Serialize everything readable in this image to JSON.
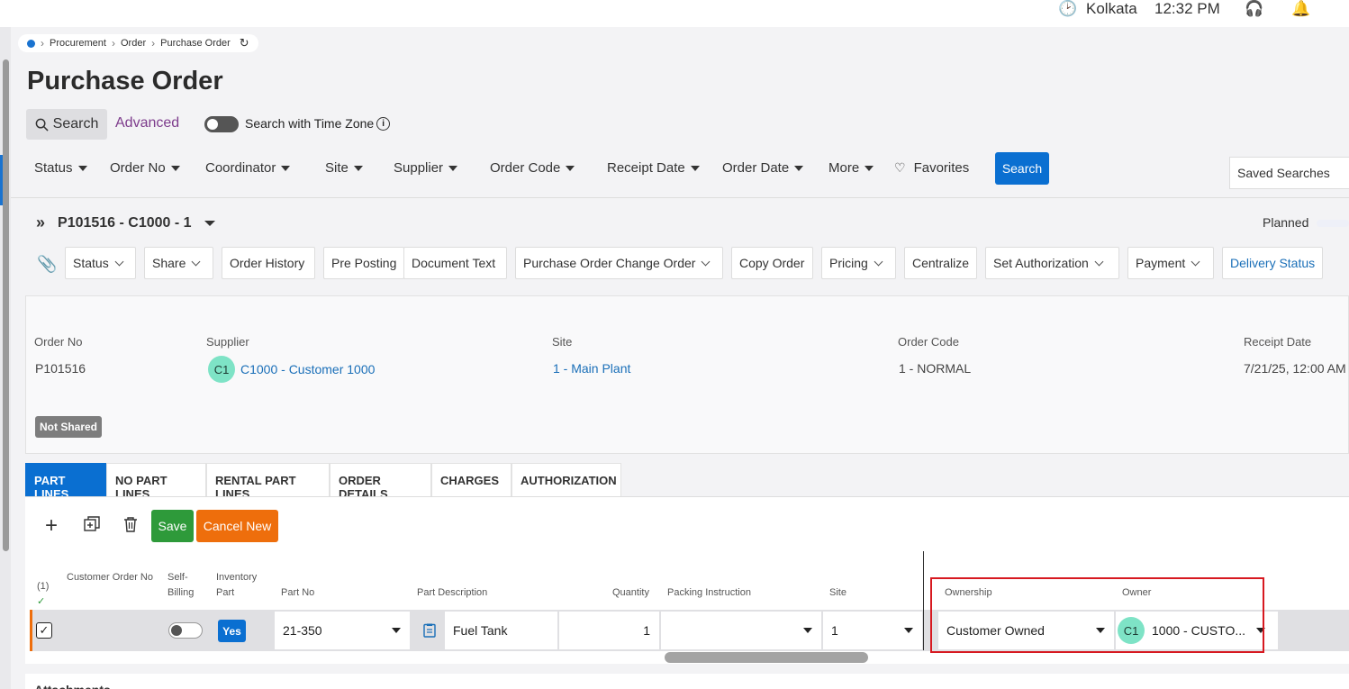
{
  "topbar": {
    "location": "Kolkata",
    "time": "12:32 PM"
  },
  "breadcrumb": [
    "Procurement",
    "Order",
    "Purchase Order"
  ],
  "page_title": "Purchase Order",
  "search_modes": {
    "search": "Search",
    "advanced": "Advanced",
    "time_zone_label": "Search with Time Zone"
  },
  "filters": [
    "Status",
    "Order No",
    "Coordinator",
    "Site",
    "Supplier",
    "Order Code",
    "Receipt Date",
    "Order Date",
    "More"
  ],
  "favorites": "Favorites",
  "search_button": "Search",
  "saved_searches": "Saved Searches",
  "record": {
    "title": "P101516 - C1000 - 1",
    "status": "Planned"
  },
  "actions": [
    "Status",
    "Share",
    "Order History",
    "Pre Posting",
    "Document Text",
    "Purchase Order Change Order",
    "Copy Order",
    "Pricing",
    "Centralize",
    "Set Authorization",
    "Payment",
    "Delivery Status"
  ],
  "header_fields": {
    "order_no": {
      "label": "Order No",
      "value": "P101516"
    },
    "supplier": {
      "label": "Supplier",
      "avatar": "C1",
      "value": "C1000 - Customer 1000"
    },
    "site": {
      "label": "Site",
      "value": "1 - Main Plant"
    },
    "order_code": {
      "label": "Order Code",
      "value": "1 - NORMAL"
    },
    "receipt_date": {
      "label": "Receipt Date",
      "value": "7/21/25, 12:00 AM"
    }
  },
  "share_badge": "Not Shared",
  "tabs": [
    "PART LINES",
    "NO PART LINES",
    "RENTAL PART LINES",
    "ORDER DETAILS",
    "CHARGES",
    "AUTHORIZATION"
  ],
  "grid_toolbar": {
    "save": "Save",
    "cancel_new": "Cancel New"
  },
  "grid_columns": {
    "selected_count": "(1)",
    "customer_order_no": "Customer Order No",
    "self_billing": "Self-Billing",
    "inventory_part": "Inventory Part",
    "part_no": "Part No",
    "part_description": "Part Description",
    "quantity": "Quantity",
    "packing_instruction": "Packing Instruction",
    "site": "Site",
    "ownership": "Ownership",
    "owner": "Owner"
  },
  "grid_row": {
    "inventory_part": "Yes",
    "part_no": "21-350",
    "part_description": "Fuel Tank",
    "quantity": "1",
    "packing_instruction": "",
    "site": "1",
    "ownership": "Customer Owned",
    "owner_avatar": "C1",
    "owner": "1000 - CUSTO..."
  },
  "attachments": "Attachments",
  "colors": {
    "primary": "#0a6fd1",
    "save": "#2e9a3a",
    "cancel": "#ee6e0c",
    "highlight": "#d71920",
    "avatar": "#7ee3c6"
  }
}
